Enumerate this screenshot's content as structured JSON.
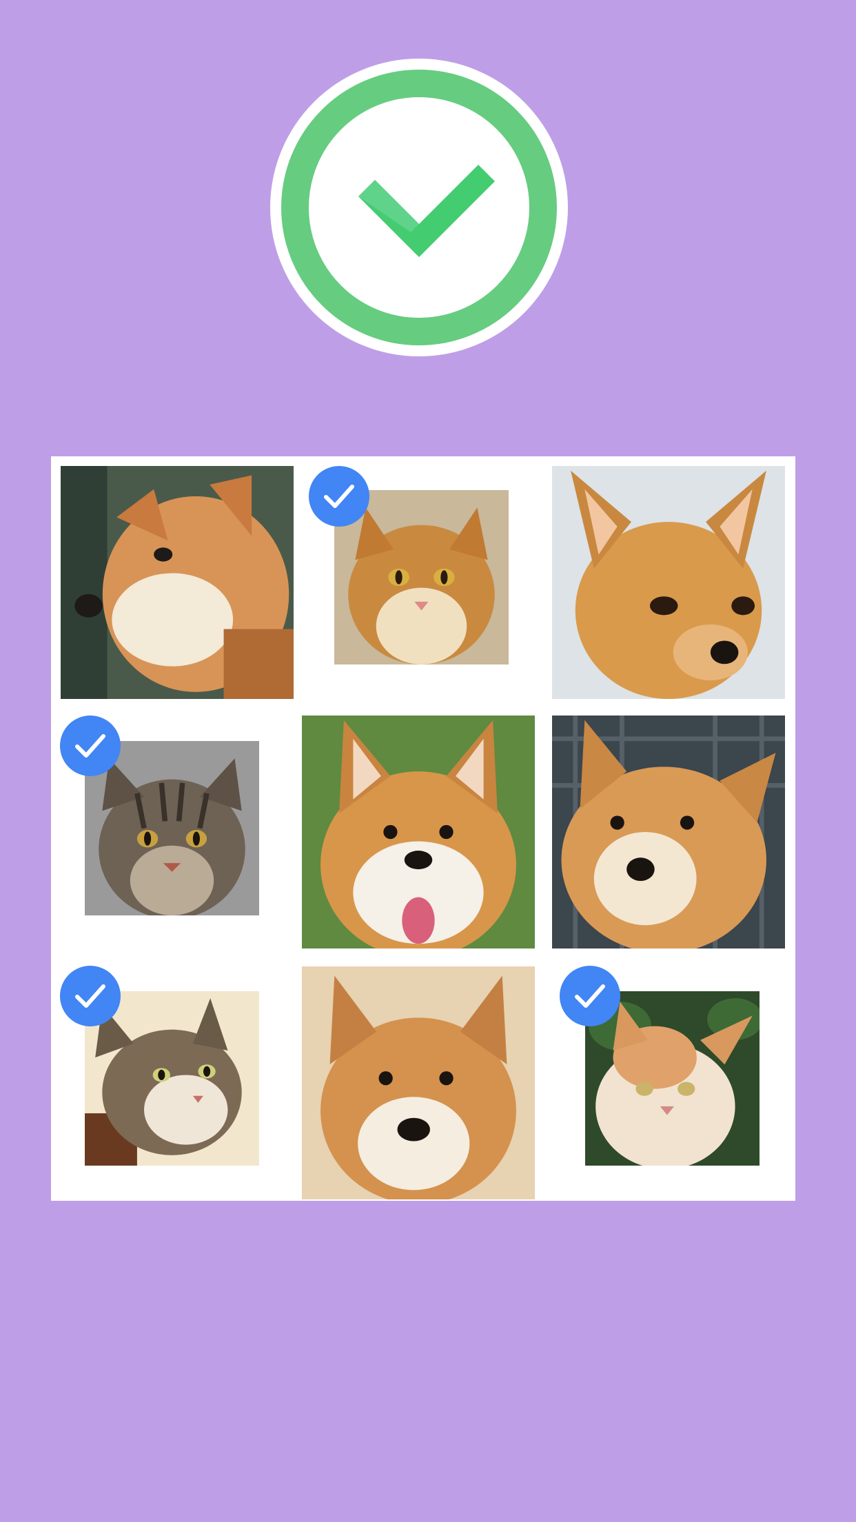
{
  "success_badge": {
    "icon": "check-circle-icon",
    "ring_color": "#66cc80",
    "check_color": "#44cc70"
  },
  "captcha": {
    "selected_color": "#4285f4",
    "tiles": [
      {
        "subject": "shiba-inu-dog",
        "selected": false
      },
      {
        "subject": "orange-tabby-cat",
        "selected": true
      },
      {
        "subject": "chihuahua-dog",
        "selected": false
      },
      {
        "subject": "gray-tabby-cat",
        "selected": true
      },
      {
        "subject": "corgi-dog",
        "selected": false
      },
      {
        "subject": "shiba-inu-dog",
        "selected": false
      },
      {
        "subject": "tabby-kitten",
        "selected": true
      },
      {
        "subject": "shiba-inu-dog",
        "selected": false
      },
      {
        "subject": "orange-white-cat",
        "selected": true
      }
    ]
  }
}
